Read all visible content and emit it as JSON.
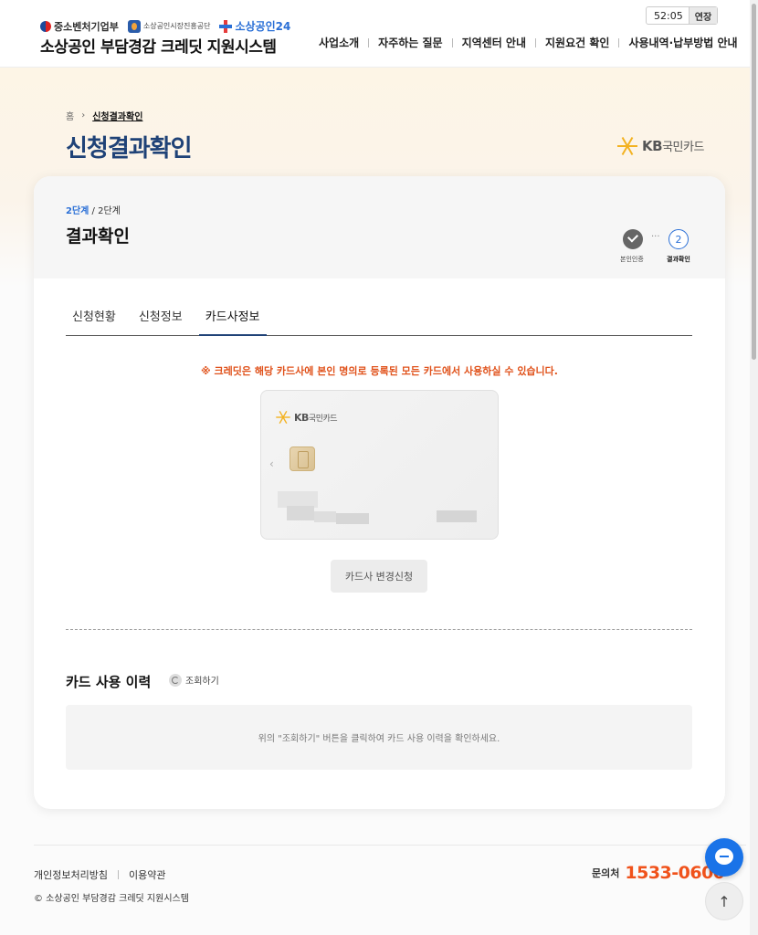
{
  "header": {
    "logos": {
      "mss": "중소벤처기업부",
      "semas": "소상공인시장진흥공단",
      "sbiz24": "소상공인24"
    },
    "site_title": "소상공인 부담경감 크레딧 지원시스템",
    "timer": "52:05",
    "extend_label": "연장",
    "nav": [
      "사업소개",
      "자주하는 질문",
      "지역센터 안내",
      "지원요건 확인",
      "사용내역·납부방법 안내"
    ]
  },
  "breadcrumb": {
    "home": "홈",
    "current": "신청결과확인"
  },
  "page_title": "신청결과확인",
  "brand": {
    "kb": "KB",
    "card_company": "국민카드"
  },
  "step": {
    "current": "2단계",
    "total": " / 2단계",
    "title": "결과확인",
    "steps": [
      {
        "label": "본인인증",
        "status": "done"
      },
      {
        "number": "2",
        "label": "결과확인",
        "status": "current"
      }
    ],
    "dots": "···"
  },
  "tabs": [
    "신청현황",
    "신청정보",
    "카드사정보"
  ],
  "active_tab": "카드사정보",
  "notice": "※ 크레딧은 해당 카드사에 본인 명의로 등록된 모든 카드에서 사용하실 수 있습니다.",
  "card_prev_arrow": "‹",
  "change_button": "카드사 변경신청",
  "history": {
    "title": "카드 사용 이력",
    "lookup_label": "조회하기",
    "empty_message": "위의 \"조회하기\" 버튼을 클릭하여 카드 사용 이력을 확인하세요."
  },
  "footer": {
    "privacy": "개인정보처리방침",
    "terms": "이용약관",
    "copyright": "© 소상공인 부담경감 크레딧 지원시스템",
    "contact_label": "문의처",
    "phone": "1533-0600"
  },
  "top_arrow": "↑",
  "colors": {
    "title_navy": "#1f4277",
    "accent_blue": "#2a6fd6",
    "notice_orange": "#e0521b",
    "phone_orange": "#f0521b",
    "kb_yellow": "#f3b222"
  }
}
